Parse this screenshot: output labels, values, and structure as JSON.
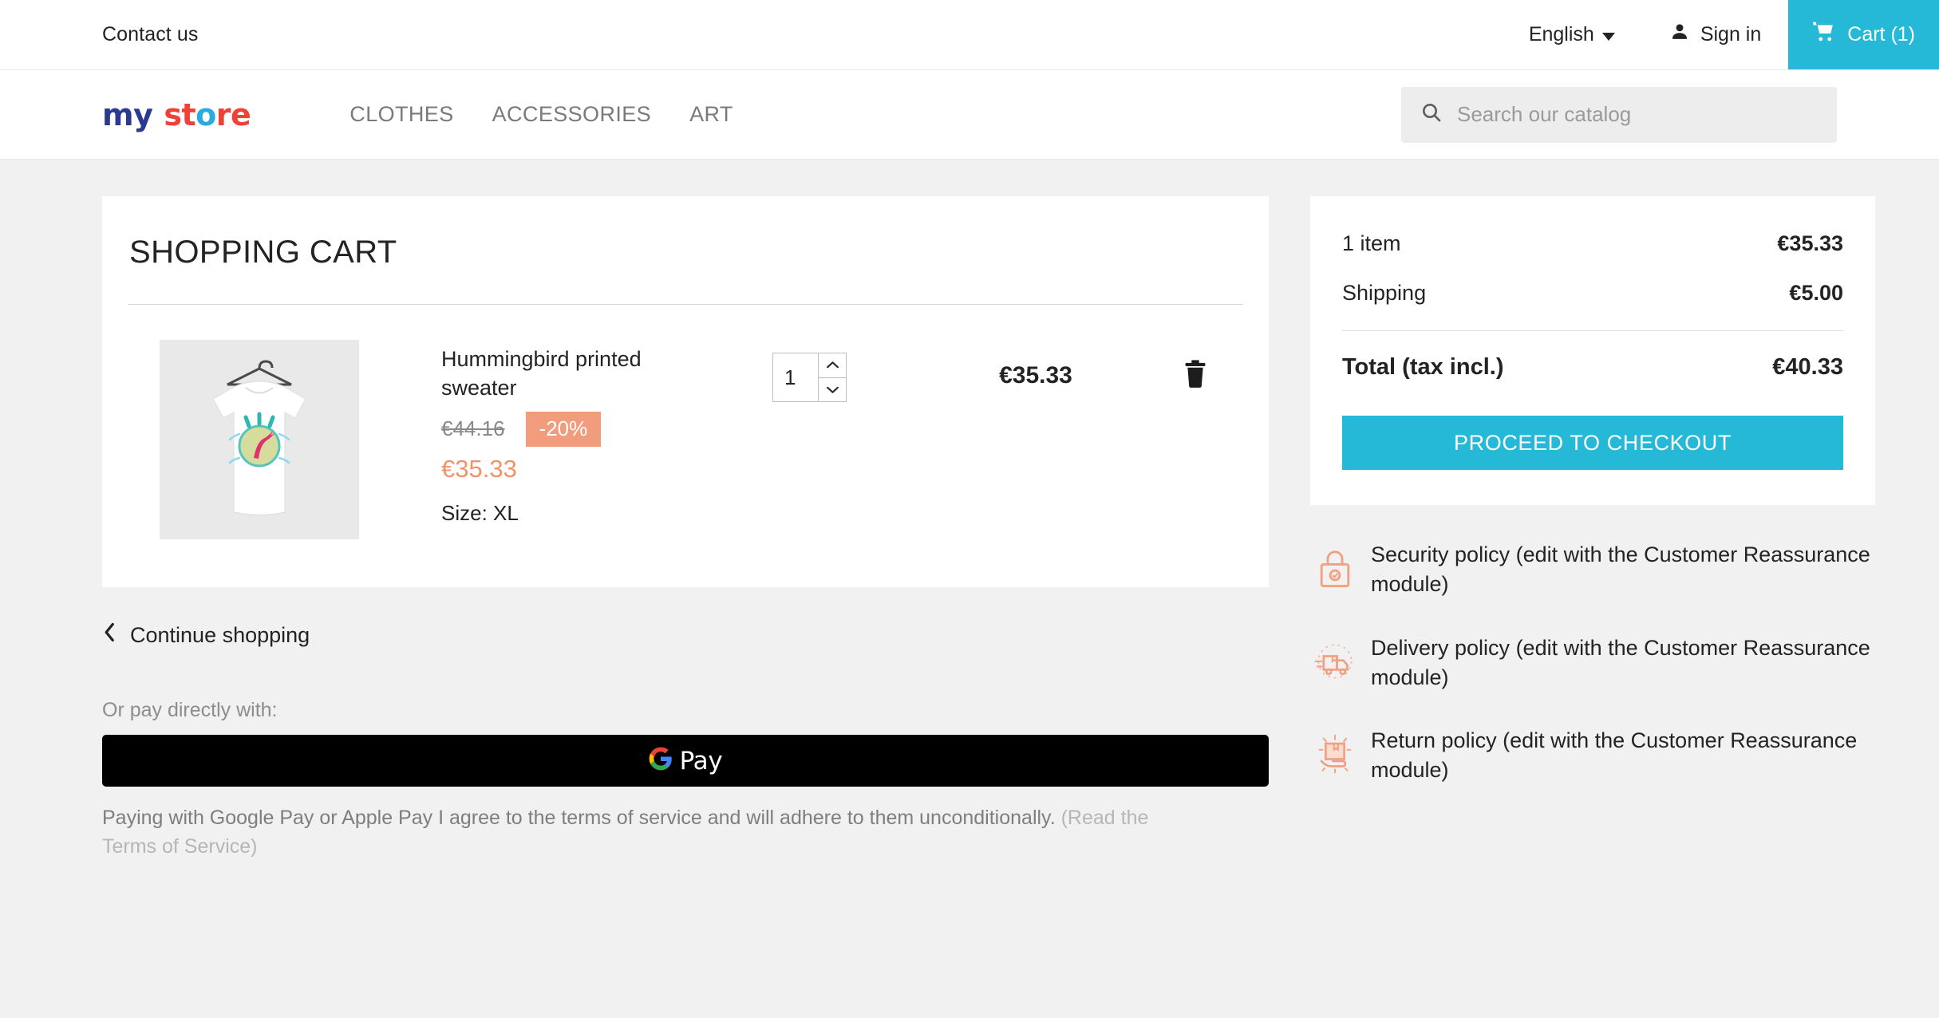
{
  "topbar": {
    "contact_label": "Contact us",
    "language": "English",
    "signin_label": "Sign in",
    "cart_label": "Cart (1)"
  },
  "header": {
    "logo": {
      "part1": "my",
      "part2": "st",
      "part3": "o",
      "part4": "re"
    },
    "nav": [
      {
        "label": "CLOTHES"
      },
      {
        "label": "ACCESSORIES"
      },
      {
        "label": "ART"
      }
    ],
    "search": {
      "placeholder": "Search our catalog",
      "value": ""
    }
  },
  "cart": {
    "title": "SHOPPING CART",
    "item": {
      "name": "Hummingbird printed sweater",
      "price_old": "€44.16",
      "discount_badge": "-20%",
      "price_new": "€35.33",
      "size_label": "Size: XL",
      "quantity": "1",
      "line_total": "€35.33"
    },
    "continue_label": "Continue shopping"
  },
  "payment": {
    "or_pay_label": "Or pay directly with:",
    "gpay_label": "Pay",
    "terms_text": "Paying with Google Pay or Apple Pay I agree to the terms of service and will adhere to them unconditionally. ",
    "terms_link": "(Read the Terms of Service)"
  },
  "summary": {
    "items_label": "1 item",
    "items_value": "€35.33",
    "shipping_label": "Shipping",
    "shipping_value": "€5.00",
    "total_label": "Total (tax incl.)",
    "total_value": "€40.33",
    "checkout_label": "PROCEED TO CHECKOUT"
  },
  "policies": [
    {
      "title": "Security policy",
      "body": " (edit with the Customer Reassurance module)",
      "icon": "lock-icon"
    },
    {
      "title": "Delivery policy",
      "body": " (edit with the Customer Reassurance module)",
      "icon": "truck-icon"
    },
    {
      "title": "Return policy",
      "body": " (edit with the Customer Reassurance module)",
      "icon": "return-box-icon"
    }
  ],
  "colors": {
    "accent_teal": "#25b9d7",
    "accent_salmon": "#f19c7c",
    "price_orange": "#f0926a",
    "page_bg": "#f1f1f1"
  }
}
